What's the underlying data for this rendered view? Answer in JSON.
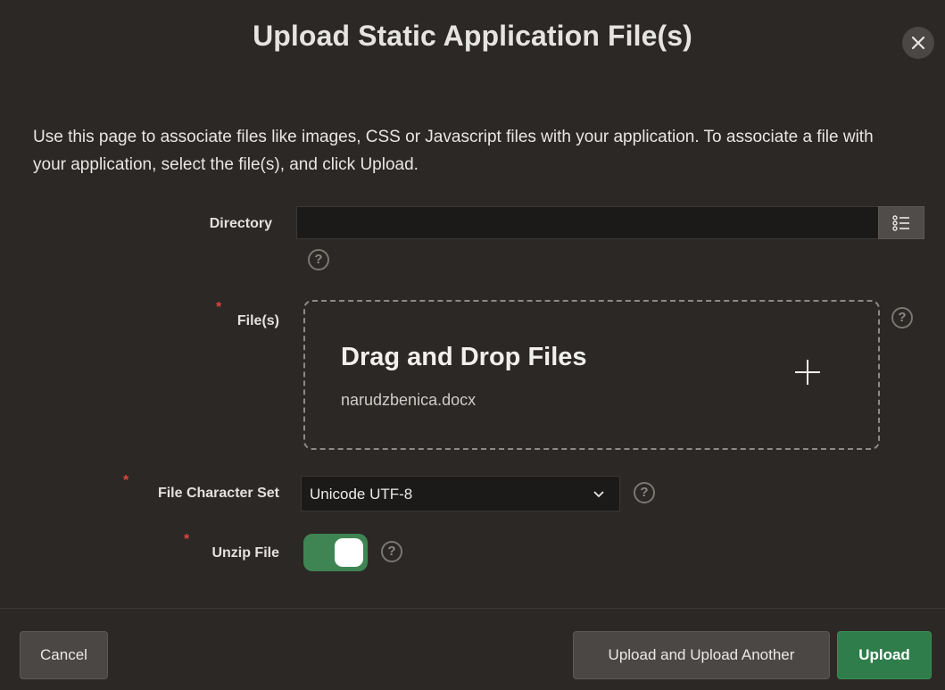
{
  "dialog": {
    "title": "Upload Static Application File(s)",
    "close_icon": "close-icon",
    "description": "Use this page to associate files like images, CSS or Javascript files with your application. To associate a file with your application, select the file(s), and click Upload."
  },
  "form": {
    "directory": {
      "label": "Directory",
      "value": "",
      "lov_icon": "list-icon",
      "help": "?"
    },
    "files": {
      "label": "File(s)",
      "required_mark": "*",
      "dropzone_title": "Drag and Drop Files",
      "selected_file": "narudzbenica.docx",
      "add_icon": "plus-icon",
      "help": "?"
    },
    "charset": {
      "label": "File Character Set",
      "required_mark": "*",
      "value": "Unicode UTF-8",
      "help": "?"
    },
    "unzip": {
      "label": "Unzip File",
      "required_mark": "*",
      "on": true,
      "help": "?"
    }
  },
  "buttons": {
    "cancel": "Cancel",
    "upload_another": "Upload and Upload Another",
    "upload": "Upload"
  },
  "colors": {
    "background": "#2b2826",
    "primary": "#2f7d4a",
    "toggle_on": "#3f8554",
    "required": "#d9463e"
  }
}
